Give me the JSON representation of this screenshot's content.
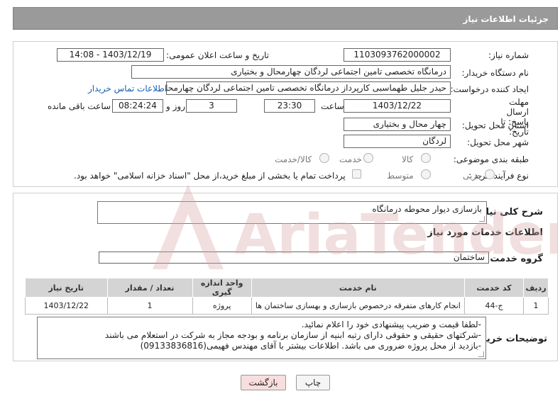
{
  "header": {
    "title": "جزئیات اطلاعات نیاز"
  },
  "form": {
    "need_number_label": "شماره نیاز:",
    "need_number": "1103093762000002",
    "announce_label": "تاریخ و ساعت اعلان عمومی:",
    "announce_value": "1403/12/19 - 14:08",
    "buyer_org_label": "نام دستگاه خریدار:",
    "buyer_org": "درمانگاه تخصصی تامین اجتماعی لردگان چهارمحال و بختیاری",
    "creator_label": "ایجاد کننده درخواست:",
    "creator": "حیدر جلیل طهماسبی کارپرداز درمانگاه تخصصی تامین اجتماعی لردگان چهارمحا",
    "contact_link": "اطلاعات تماس خریدار",
    "deadline_label": "مهلت ارسال پاسخ: تا تاریخ:",
    "deadline_date": "1403/12/22",
    "time_label": "ساعت",
    "deadline_time": "23:30",
    "days_value": "3",
    "days_label": "روز و",
    "remaining_time": "08:24:24",
    "remaining_label": "ساعت باقی مانده",
    "province_label": "استان محل تحویل:",
    "province": "چهار محال و بختیاری",
    "city_label": "شهر محل تحویل:",
    "city": "لردگان",
    "category_label": "طبقه بندی موضوعی:",
    "category_options": [
      "کالا",
      "خدمت",
      "کالا/خدمت"
    ],
    "process_label": "نوع فرآیند خرید :",
    "process_options": [
      "جزیی",
      "متوسط"
    ],
    "payment_note": "پرداخت تمام یا بخشی از مبلغ خرید،از محل \"اسناد خزانه اسلامی\" خواهد بود."
  },
  "summary": {
    "label": "شرح کلی نیاز:",
    "value": "بازسازی دیوار محوطه درمانگاه"
  },
  "services": {
    "section_title": "اطلاعات خدمات مورد نیاز",
    "group_label": "گروه خدمت:",
    "group_value": "ساختمان",
    "columns": [
      "ردیف",
      "کد خدمت",
      "نام خدمت",
      "واحد اندازه گیری",
      "تعداد / مقدار",
      "تاریخ نیاز"
    ],
    "rows": [
      [
        "1",
        "ج-44",
        "انجام کارهای متفرقه درخصوص بازسازی و بهسازی ساختمان ها",
        "پروژه",
        "1",
        "1403/12/22"
      ]
    ]
  },
  "buyer_notes": {
    "label": "توضیحات خریدار:",
    "lines": [
      "-لطفا قیمت و ضریب پیشنهادی خود را اعلام نمائید.",
      "-شرکتهای حقیقی و حقوقی دارای رتبه ابنیه از سازمان برنامه و بودجه مجاز به شرکت در استعلام می باشند",
      "-بازدید از محل پروژه ضروری می باشد.  اطلاعات بیشتر با آقای مهندس فهیمی(09133836816)"
    ]
  },
  "buttons": {
    "print": "چاپ",
    "back": "بازگشت"
  },
  "watermark": {
    "text": "AriaTender.neT"
  },
  "colors": {
    "header": "#9a9a9a",
    "link": "#1a5fb4",
    "back_button": "#f9dede",
    "watermark": "#e7b9b9"
  }
}
